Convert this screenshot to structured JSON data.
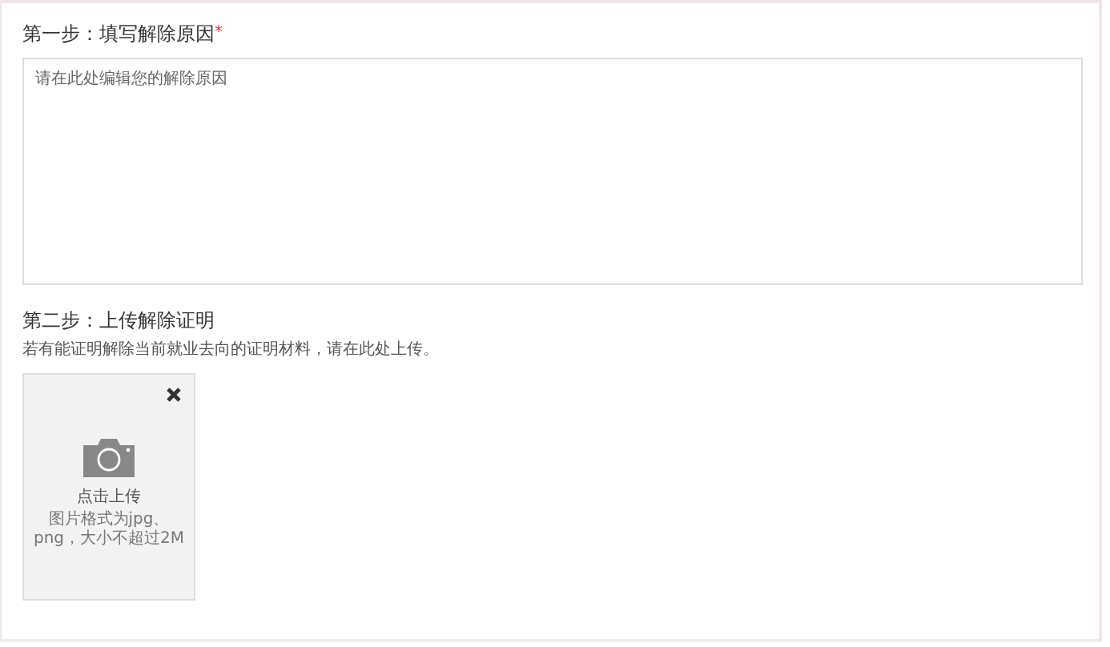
{
  "step1": {
    "title": "第一步：填写解除原因",
    "required_mark": "*",
    "reason_field": {
      "placeholder": "请在此处编辑您的解除原因"
    }
  },
  "step2": {
    "title": "第二步：上传解除证明",
    "description": "若有能证明解除当前就业去向的证明材料，请在此处上传。",
    "upload": {
      "label": "点击上传",
      "hint": "图片格式为jpg、png，大小不超过2M",
      "removable": true
    }
  }
}
